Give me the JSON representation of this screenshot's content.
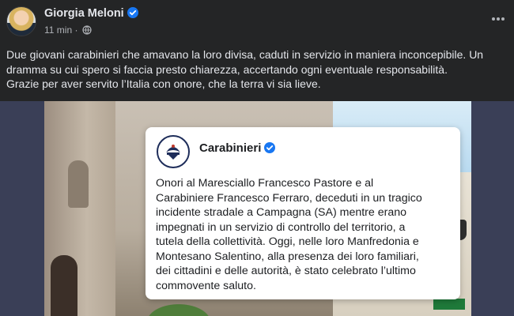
{
  "post": {
    "author": "Giorgia Meloni",
    "timestamp": "11 min",
    "separator": "·",
    "caption_lines": [
      "Due giovani carabinieri che amavano la loro divisa, caduti in servizio in maniera inconcepibile. Un",
      "dramma su cui spero si faccia presto chiarezza, accertando ogni eventuale responsabilità.",
      "Grazie per aver servito l’Italia con onore, che la terra vi sia lieve."
    ]
  },
  "embedded_card": {
    "account_name": "Carabinieri",
    "text_lines": [
      "Onori al Maresciallo Francesco Pastore e al",
      "Carabiniere Francesco Ferraro, deceduti in un tragico",
      "incidente stradale a Campagna (SA) mentre erano",
      "impegnati in un servizio di controllo del territorio, a",
      "tutela della collettività. Oggi, nelle loro Manfredonia e",
      "Montesano Salentino, alla presenza dei loro familiari,",
      "dei cittadini e delle autorità, è stato celebrato l’ultimo",
      "commovente saluto."
    ]
  },
  "icons": {
    "verified": "verified-badge-icon",
    "audience": "globe-icon",
    "more": "more-options-icon"
  },
  "colors": {
    "background": "#242526",
    "text_primary": "#e4e6eb",
    "text_secondary": "#b0b3b8",
    "verified_blue": "#1877f2",
    "media_backdrop": "#3a3f57"
  }
}
